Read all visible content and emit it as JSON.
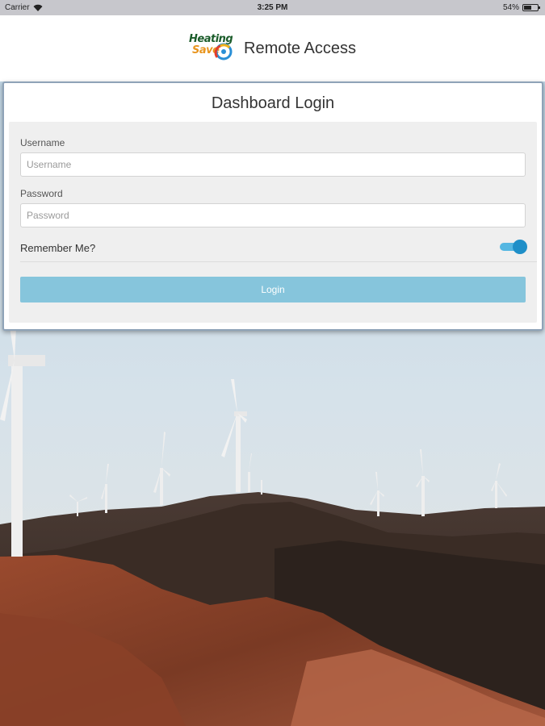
{
  "status_bar": {
    "carrier": "Carrier",
    "time": "3:25 PM",
    "battery_percent": "54%",
    "battery_level": 0.54
  },
  "header": {
    "logo_line1": "Heating",
    "logo_line2": "Save",
    "title": "Remote Access"
  },
  "login": {
    "title": "Dashboard Login",
    "username_label": "Username",
    "username_placeholder": "Username",
    "username_value": "",
    "password_label": "Password",
    "password_placeholder": "Password",
    "password_value": "",
    "remember_label": "Remember Me?",
    "remember_on": true,
    "login_button": "Login"
  },
  "colors": {
    "toggle_accent": "#1f8fc8",
    "login_button": "#86c5dc",
    "card_border": "#8fa3b8"
  }
}
